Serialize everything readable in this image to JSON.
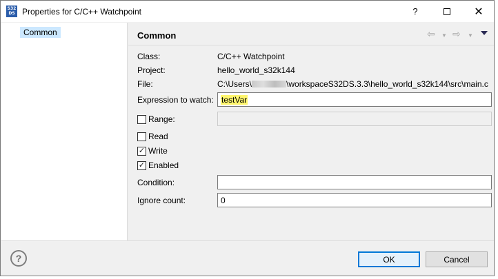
{
  "window": {
    "app_icon_text": "S32\nDS",
    "title": "Properties for C/C++ Watchpoint",
    "help_glyph": "?",
    "close_glyph": "✕"
  },
  "nav": {
    "items": [
      {
        "label": "Common",
        "selected": true
      }
    ]
  },
  "page": {
    "title": "Common",
    "class_label": "Class:",
    "class_value": "C/C++ Watchpoint",
    "project_label": "Project:",
    "project_value": "hello_world_s32k144",
    "file_label": "File:",
    "file_value_prefix": "C:\\Users\\",
    "file_value_suffix": "\\workspaceS32DS.3.3\\hello_world_s32k144\\src\\main.c",
    "expression_label": "Expression to watch:",
    "expression_value": "testVar",
    "range_label": "Range:",
    "range_checked": false,
    "range_value": "",
    "read_label": "Read",
    "read_checked": false,
    "write_label": "Write",
    "write_checked": true,
    "enabled_label": "Enabled",
    "enabled_checked": true,
    "condition_label": "Condition:",
    "condition_value": "",
    "ignore_count_label": "Ignore count:",
    "ignore_count_value": "0",
    "check_glyph": "✓"
  },
  "footer": {
    "ok_label": "OK",
    "cancel_label": "Cancel",
    "help_glyph": "?"
  },
  "colors": {
    "selection": "#cce8ff",
    "highlight": "#fff66d",
    "default_button_border": "#0078d7"
  }
}
